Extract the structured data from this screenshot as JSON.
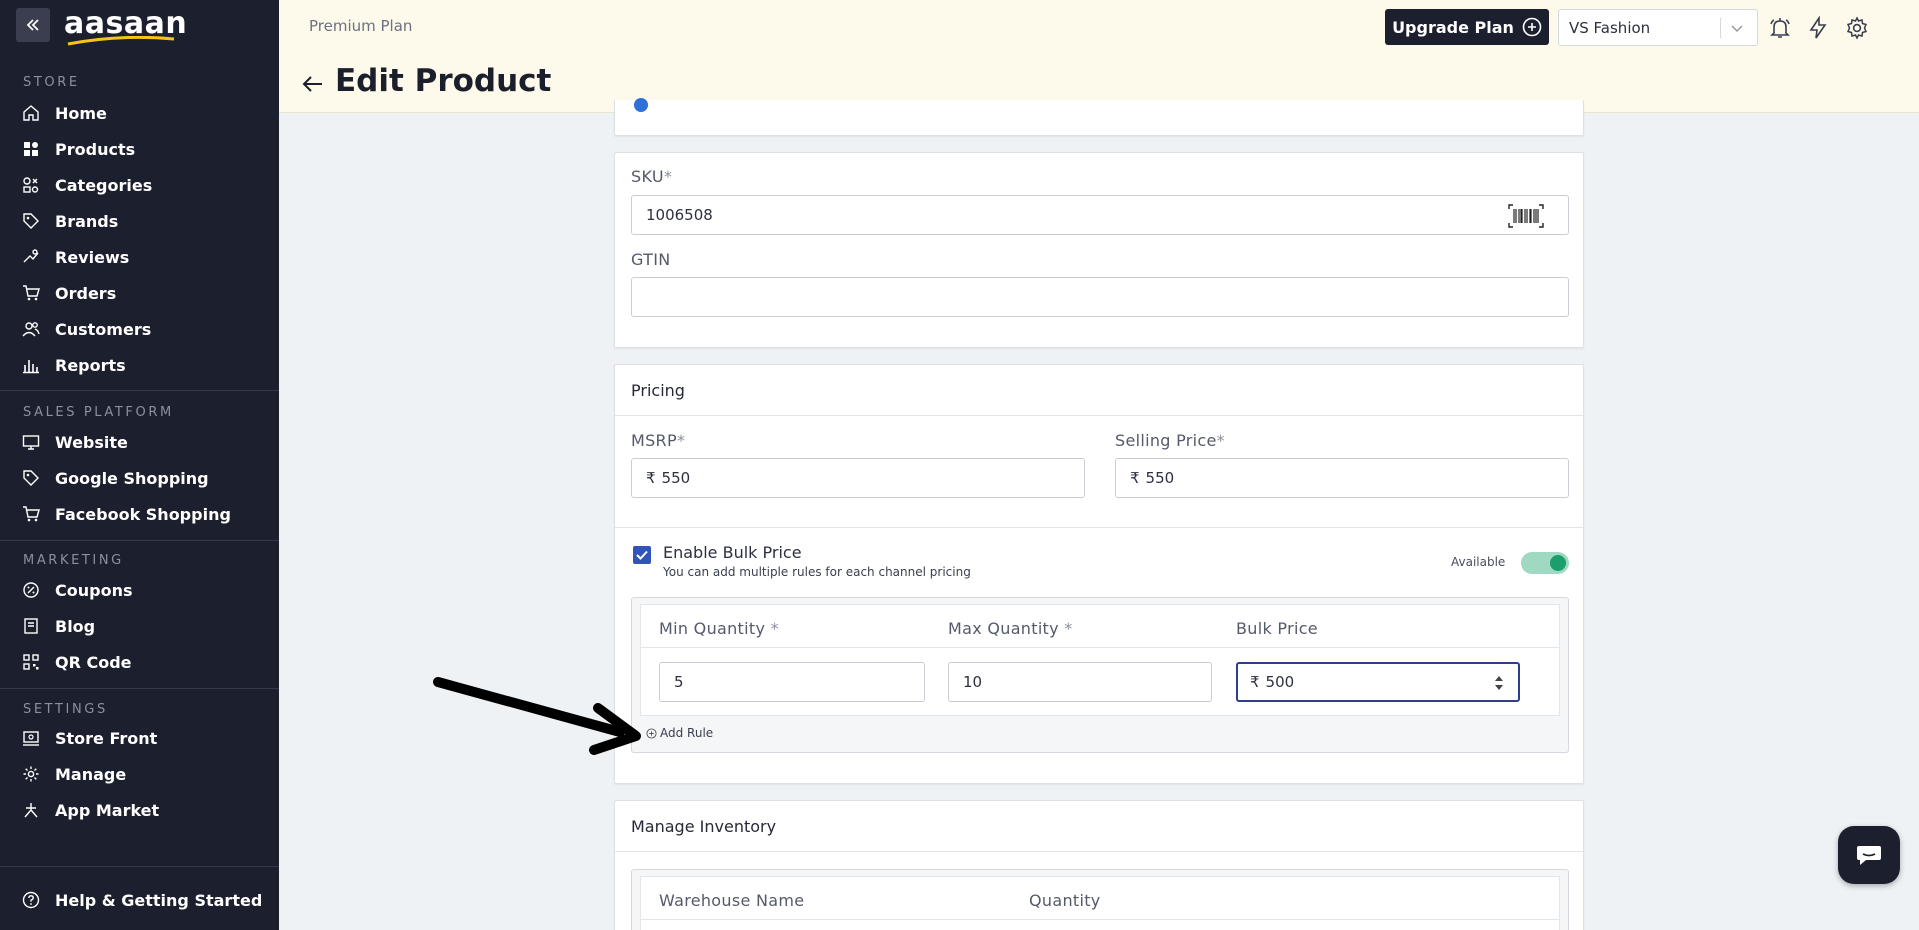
{
  "sidebar": {
    "logo_text": "aasaan",
    "sections": {
      "store": "STORE",
      "sales_platform": "SALES PLATFORM",
      "marketing": "MARKETING",
      "settings": "SETTINGS"
    },
    "items": {
      "home": "Home",
      "products": "Products",
      "categories": "Categories",
      "brands": "Brands",
      "reviews": "Reviews",
      "orders": "Orders",
      "customers": "Customers",
      "reports": "Reports",
      "website": "Website",
      "google_shopping": "Google Shopping",
      "facebook_shopping": "Facebook Shopping",
      "coupons": "Coupons",
      "blog": "Blog",
      "qr_code": "QR Code",
      "store_front": "Store Front",
      "manage": "Manage",
      "app_market": "App Market",
      "help": "Help & Getting Started"
    }
  },
  "header": {
    "plan": "Premium Plan",
    "title": "Edit Product",
    "upgrade_label": "Upgrade Plan",
    "store_name": "VS Fashion"
  },
  "sku_card": {
    "sku_label": "SKU",
    "sku_value": "1006508",
    "gtin_label": "GTIN",
    "gtin_value": ""
  },
  "pricing": {
    "title": "Pricing",
    "msrp_label": "MSRP",
    "msrp_value": "550",
    "selling_label": "Selling Price",
    "selling_value": "550",
    "currency": "₹",
    "required_mark": "*",
    "bulk_label": "Enable Bulk Price",
    "bulk_help": "You can add multiple rules for each channel pricing",
    "bulk_enabled": true,
    "available_label": "Available",
    "available_on": true,
    "table_headers": {
      "min": "Min Quantity",
      "max": "Max Quantity",
      "price": "Bulk Price"
    },
    "rule": {
      "min": "5",
      "max": "10",
      "price": "500"
    },
    "add_rule": "Add Rule"
  },
  "inventory": {
    "title": "Manage Inventory",
    "headers": {
      "warehouse": "Warehouse Name",
      "quantity": "Quantity"
    }
  },
  "colors": {
    "sidebar_bg": "#1c1f2e",
    "header_bg": "#fdfaeb",
    "accent_blue": "#3154b8",
    "toggle_green": "#1a9e6a"
  }
}
